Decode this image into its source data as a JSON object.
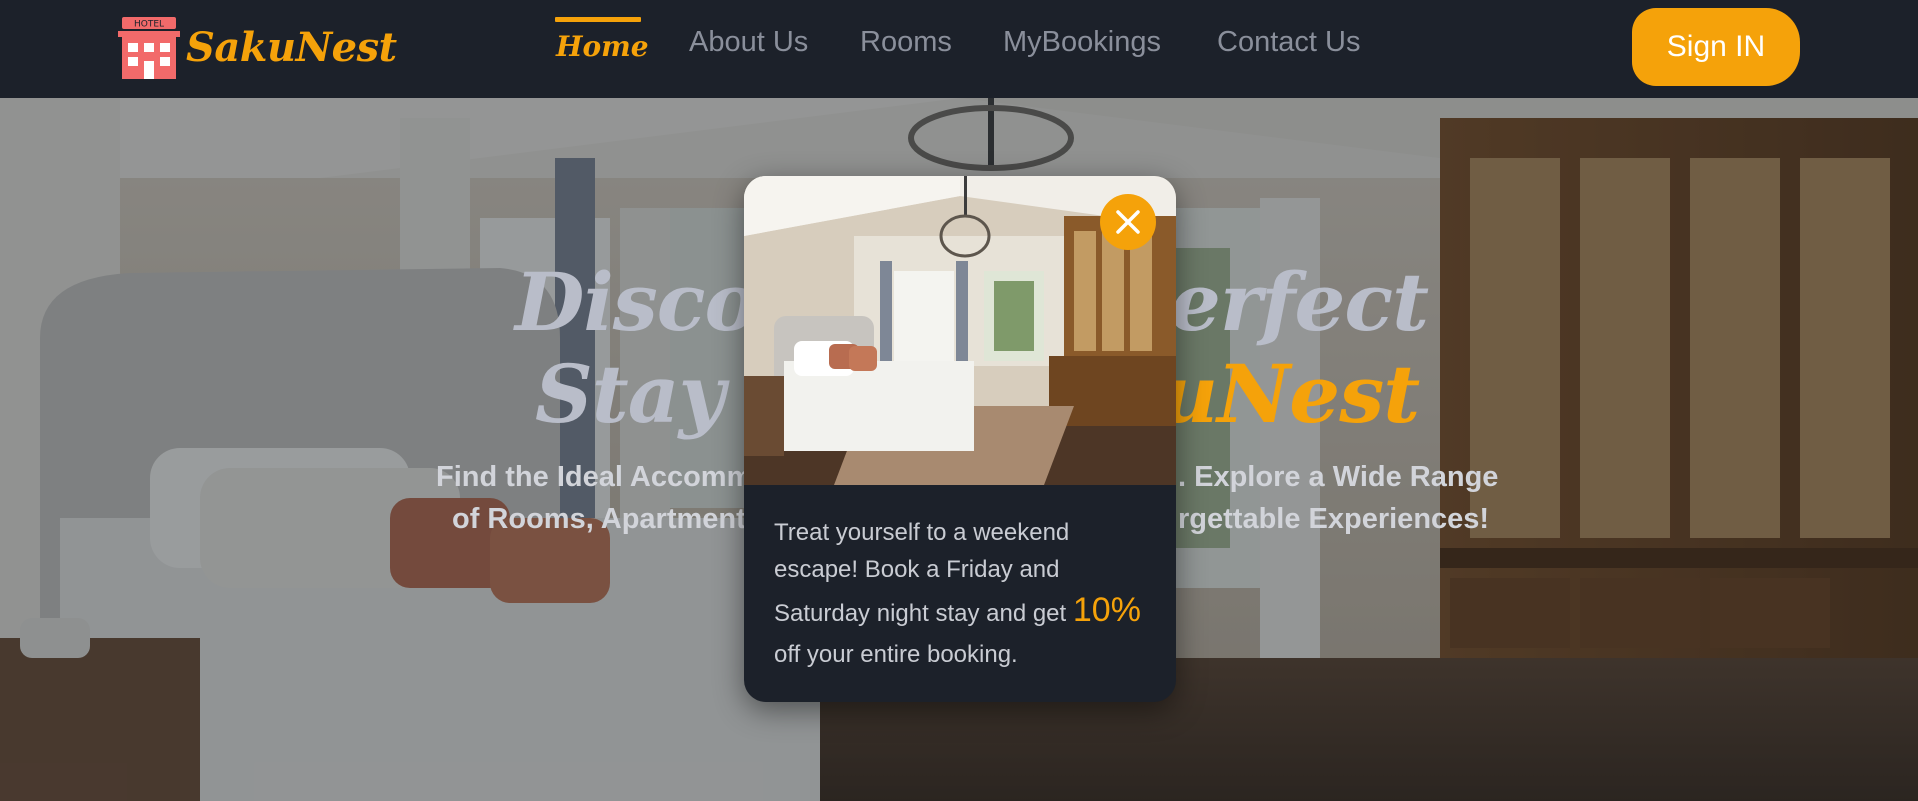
{
  "brand": {
    "name": "SakuNest",
    "sign_text": "HOTEL",
    "accent_color": "#f5a20a",
    "icon": "hotel-icon"
  },
  "nav": {
    "items": [
      {
        "label": "Home",
        "active": true
      },
      {
        "label": "About Us",
        "active": false
      },
      {
        "label": "Rooms",
        "active": false
      },
      {
        "label": "MyBookings",
        "active": false
      },
      {
        "label": "Contact Us",
        "active": false
      }
    ],
    "signin_label": "Sign IN"
  },
  "hero": {
    "title_line1_left": "Disco",
    "title_line1_right": "erfect",
    "title_line2_left": "Stay",
    "title_line2_accent": "uNest",
    "subtitle_line1_left": "Find the Ideal Accomm",
    "subtitle_line1_right": ". Explore a Wide Range",
    "subtitle_line2_left": "of Rooms, Apartments",
    "subtitle_line2_right": "rgettable Experiences!"
  },
  "modal": {
    "close_icon": "close-icon",
    "offer_line1": "Treat yourself to a weekend",
    "offer_line2": "escape! Book a Friday and",
    "offer_line3_pre": "Saturday night stay and get ",
    "offer_percent": "10%",
    "offer_line4": "off your entire booking."
  }
}
